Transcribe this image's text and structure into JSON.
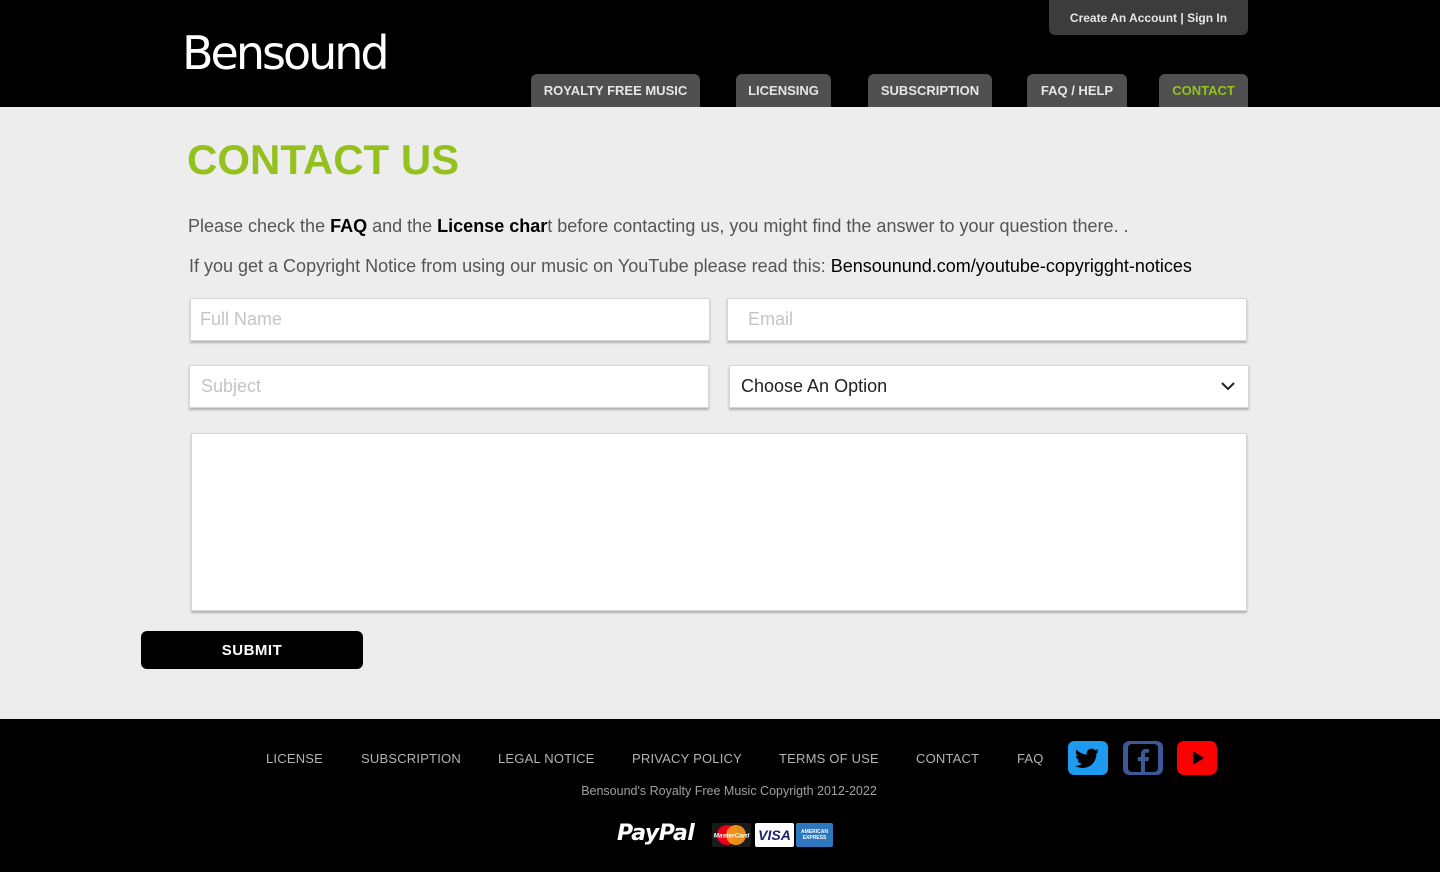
{
  "header": {
    "logo_text": "Bensound",
    "account_link": "Create An Account | Sign In",
    "nav": [
      {
        "label": "ROYALTY FREE MUSIC"
      },
      {
        "label": "LICENSING"
      },
      {
        "label": "SUBSCRIPTION"
      },
      {
        "label": "FAQ / HELP"
      },
      {
        "label": "CONTACT"
      }
    ],
    "active_color": "#95c11f"
  },
  "main": {
    "title": "CONTACT US",
    "intro": {
      "pre": "Please check the ",
      "faq": "FAQ",
      "mid": " and the ",
      "license": "License char",
      "post": "t before contacting us, you might find the answer to your question there. ."
    },
    "intro2": {
      "text": "If you get a Copyright Notice from using our music on YouTube please read this: ",
      "link": "Bensounund.com/youtube-copyrigght-notices"
    },
    "form": {
      "name_placeholder": "Full Name",
      "email_placeholder": "Email",
      "subject_placeholder": "Subject",
      "select_value": "Choose An Option",
      "message_value": "",
      "submit_label": "SUBMIT"
    }
  },
  "footer": {
    "links": [
      "LICENSE",
      "SUBSCRIPTION",
      "LEGAL NOTICE",
      "PRIVACY POLICY",
      "TERMS OF USE",
      "CONTACT",
      "FAQ"
    ],
    "social": [
      "twitter-icon",
      "facebook-icon",
      "youtube-icon"
    ],
    "copyright": "Bensound's Royalty Free Music Copyrigth  2012-2022",
    "payment": {
      "paypal": "PayPal",
      "mastercard": "MasterCard",
      "visa": "VISA",
      "amex": "AMERICAN EXPRESS"
    }
  },
  "colors": {
    "accent_green": "#95c11f",
    "header_bg": "#000000",
    "body_bg": "#ededed",
    "twitter": "#1d9bf0",
    "facebook": "#3b5998",
    "youtube": "#ff0000"
  }
}
